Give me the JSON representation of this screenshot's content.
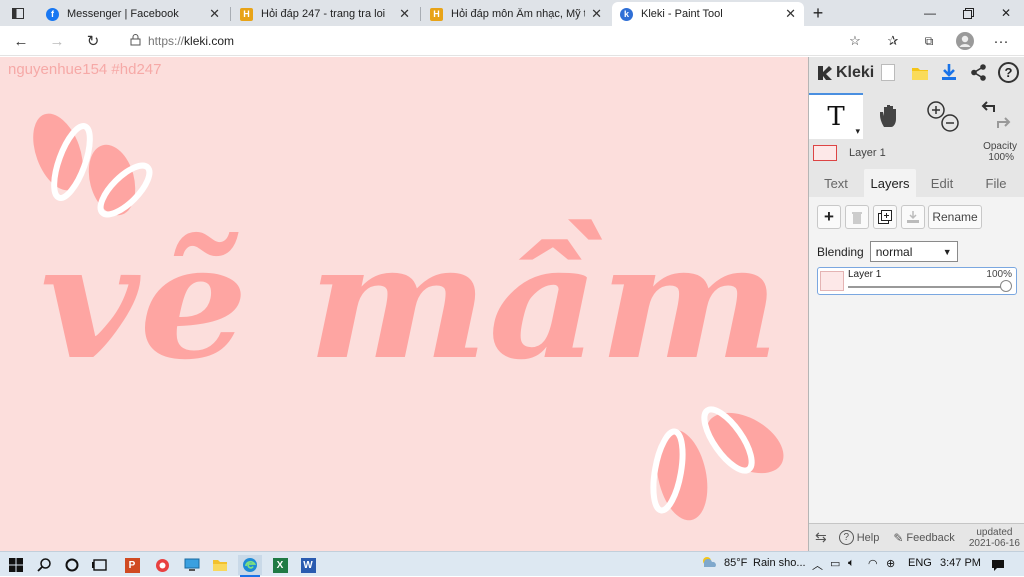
{
  "browser": {
    "tabs": [
      {
        "title": "Messenger | Facebook",
        "icon": "facebook-icon"
      },
      {
        "title": "Hỏi đáp 247 - trang tra loi",
        "icon": "hoidap-icon"
      },
      {
        "title": "Hỏi đáp môn Âm nhạc, Mỹ thuật",
        "icon": "hoidap-icon"
      },
      {
        "title": "Kleki - Paint Tool",
        "icon": "kleki-icon"
      }
    ],
    "url_protocol": "https://",
    "url_host": "kleki.com"
  },
  "canvas": {
    "watermark": "nguyenhue154 #hd247",
    "artwork_text": "vẽ mầm",
    "background_color": "#fcdedc",
    "ink_color": "#fea5a2"
  },
  "panel": {
    "logo": "Kleki",
    "current_layer": "Layer 1",
    "opacity_label": "Opacity",
    "opacity_value": "100%",
    "tabs": [
      "Text",
      "Layers",
      "Edit",
      "File"
    ],
    "active_tab": "Layers",
    "rename_label": "Rename",
    "blending_label": "Blending",
    "blending_value": "normal",
    "layers": [
      {
        "name": "Layer 1",
        "opacity": "100%",
        "opacity_level": 1.0
      }
    ],
    "help_label": "Help",
    "feedback_label": "Feedback",
    "updated_label": "updated",
    "updated_date": "2021-06-16"
  },
  "taskbar": {
    "weather_temp": "85°F",
    "weather_text": "Rain sho...",
    "language": "ENG",
    "time": "3:47 PM"
  }
}
